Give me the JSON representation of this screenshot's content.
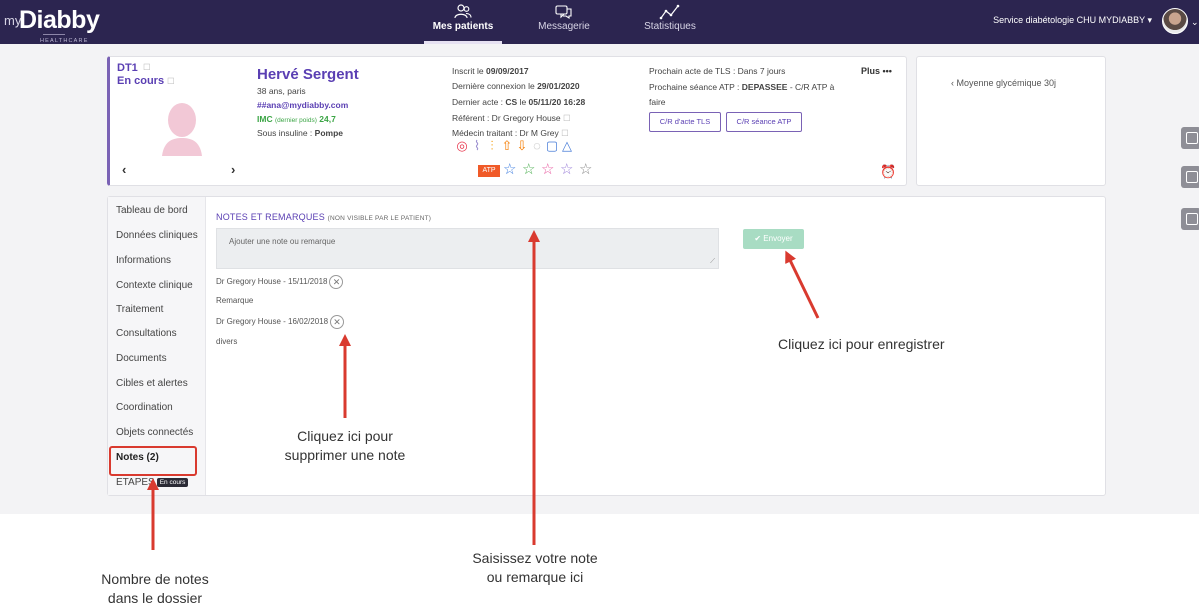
{
  "app": {
    "logo_prefix": "my",
    "logo_name": "Diabby",
    "logo_sub": "HEALTHCARE"
  },
  "nav": {
    "items": [
      {
        "label": "Mes patients",
        "icon": "patients-icon",
        "active": true
      },
      {
        "label": "Messagerie",
        "icon": "chat-icon",
        "active": false
      },
      {
        "label": "Statistiques",
        "icon": "stats-icon",
        "active": false
      }
    ],
    "service": "Service diabétologie CHU MYDIABBY ▾"
  },
  "patient": {
    "type": "DT1",
    "status": "En cours",
    "name": "Hervé Sergent",
    "age_city": "38 ans,  paris",
    "email": "##ana@mydiabby.com",
    "imc_label": "IMC",
    "imc_note": "(dernier poids)",
    "imc_value": "24,7",
    "insulin_label": "Sous insuline : ",
    "insulin_value": "Pompe",
    "inscrit_label": "Inscrit le ",
    "inscrit_value": "09/09/2017",
    "connexion_label": "Dernière connexion le ",
    "connexion_value": "29/01/2020",
    "acte_label": "Dernier acte : ",
    "acte_type": "CS",
    "acte_mid": " le ",
    "acte_value": "05/11/20 16:28",
    "referent": "Référent : Dr Gregory House",
    "medecin": "Médecin traitant : Dr M Grey",
    "tls": "Prochain acte de TLS : Dans 7 jours",
    "atp_label": "Prochaine séance ATP : ",
    "atp_value": "DEPASSEE",
    "atp_suffix": " - C/R ATP à",
    "atp_line2": "faire",
    "btn_tls": "C/R d'acte TLS",
    "btn_atp": "C/R séance ATP",
    "plus": "Plus •••",
    "atp_badge": "ATP",
    "stars_count": 5
  },
  "glycemie": {
    "label": "Moyenne glycémique 30j"
  },
  "sidebar": {
    "items": [
      "Tableau de bord",
      "Données cliniques",
      "Informations",
      "Contexte clinique",
      "Traitement",
      "Consultations",
      "Documents",
      "Cibles et alertes",
      "Coordination",
      "Objets connectés",
      "Notes (2)",
      "ETAPES"
    ],
    "etapes_badge": "En cours"
  },
  "notes": {
    "title": "NOTES ET REMARQUES",
    "title_note": "(NON VISIBLE PAR LE PATIENT)",
    "placeholder": "Ajouter une note ou remarque",
    "send_label": "✔ Envoyer",
    "entries": [
      {
        "author": "Dr Gregory House - 15/11/2018",
        "text": "Remarque"
      },
      {
        "author": "Dr Gregory House - 16/02/2018",
        "text": "divers"
      }
    ]
  },
  "annotations": {
    "register": "Cliquez ici pour enregistrer",
    "delete_1": "Cliquez ici pour",
    "delete_2": "supprimer une note",
    "input_1": "Saisissez votre note",
    "input_2": "ou remarque ici",
    "count_1": "Nombre de notes",
    "count_2": "dans le dossier"
  },
  "colors": {
    "nav_bg": "#2c2550",
    "accent": "#5a3fb3",
    "annotation_red": "#d93a2f",
    "send_green": "#a8dcc3"
  }
}
